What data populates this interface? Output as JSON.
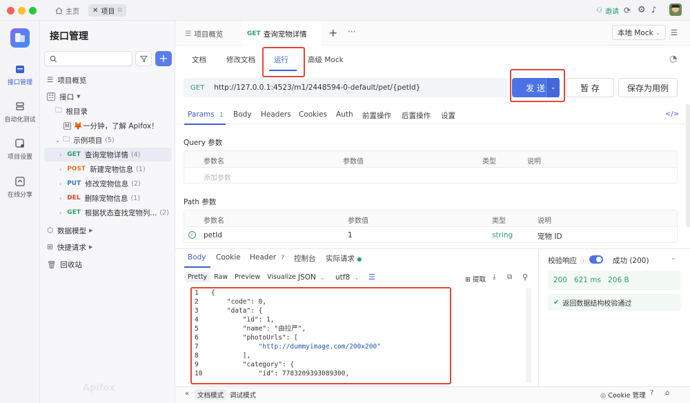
{
  "titlebar": {
    "home_label": "主页",
    "project_label": "项目",
    "invite_label": "邀请"
  },
  "sidebar": {
    "items": [
      {
        "label": "接口管理"
      },
      {
        "label": "自动化测试"
      },
      {
        "label": "项目设置"
      },
      {
        "label": "在线分享"
      }
    ]
  },
  "panel": {
    "title": "接口管理",
    "overview": "项目概览",
    "interfaces": "接口",
    "root": "根目录",
    "intro": "🦊一分钟，了解 Apifox！",
    "example_folder": "示例项目",
    "example_count": "(5)",
    "endpoints": [
      {
        "method": "GET",
        "color": "#2f9e6b",
        "name": "查询宠物详情",
        "count": "(4)"
      },
      {
        "method": "POST",
        "color": "#e0782a",
        "name": "新建宠物信息",
        "count": "(1)"
      },
      {
        "method": "PUT",
        "color": "#3a73c6",
        "name": "修改宠物信息",
        "count": "(2)"
      },
      {
        "method": "DEL",
        "color": "#d9432f",
        "name": "删除宠物信息",
        "count": "(1)"
      },
      {
        "method": "GET",
        "color": "#2f9e6b",
        "name": "根据状态查找宠物列...",
        "count": "(2)"
      }
    ],
    "data_models": "数据模型",
    "quick_request": "快捷请求",
    "recycle": "回收站",
    "watermark": "Apifox"
  },
  "top_tabs": {
    "overview": "项目概览",
    "active_method": "GET",
    "active_name": "查询宠物详情",
    "env": "本地 Mock"
  },
  "sub_tabs": [
    "文档",
    "修改文档",
    "运行",
    "高级 Mock"
  ],
  "request": {
    "method": "GET",
    "url": "http://127.0.0.1:4523/m1/2448594-0-default/pet/{petId}",
    "send": "发 送",
    "save": "暂 存",
    "save_case": "保存为用例"
  },
  "param_tabs": {
    "params": "Params",
    "params_count": "1",
    "body": "Body",
    "headers": "Headers",
    "cookies": "Cookies",
    "auth": "Auth",
    "pre": "前置操作",
    "post": "后置操作",
    "settings": "设置"
  },
  "query": {
    "title": "Query 参数",
    "col_name": "参数名",
    "col_value": "参数值",
    "col_type": "类型",
    "col_desc": "说明",
    "add_placeholder": "添加参数"
  },
  "path": {
    "title": "Path 参数",
    "col_name": "参数名",
    "col_value": "参数值",
    "col_type": "类型",
    "col_desc": "说明",
    "row": {
      "name": "petId",
      "value": "1",
      "type": "string",
      "desc": "宠物 ID"
    }
  },
  "response": {
    "tabs": {
      "body": "Body",
      "cookie": "Cookie",
      "header": "Header",
      "header_count": "7",
      "console": "控制台",
      "actual": "实际请求"
    },
    "views": [
      "Pretty",
      "Raw",
      "Preview",
      "Visualize"
    ],
    "format": "JSON",
    "encoding": "utf8",
    "extract": "提取",
    "validate_label": "校验响应",
    "success": "成功 (200)",
    "status": "200",
    "time": "621 ms",
    "size": "206 B",
    "validate_msg": "返回数据结构校验通过"
  },
  "code_lines": [
    {
      "n": "1",
      "t": "{"
    },
    {
      "n": "2",
      "t": "    \"code\": 0,"
    },
    {
      "n": "3",
      "t": "    \"data\": {"
    },
    {
      "n": "4",
      "t": "        \"id\": 1,"
    },
    {
      "n": "5",
      "t": "        \"name\": \"由拉严\","
    },
    {
      "n": "6",
      "t": "        \"photoUrls\": ["
    },
    {
      "n": "7",
      "t": "            \"http://dummyimage.com/200x200\""
    },
    {
      "n": "8",
      "t": "        ],"
    },
    {
      "n": "9",
      "t": "        \"category\": {"
    },
    {
      "n": "10",
      "t": "            \"id\": 7783209393089300,"
    }
  ],
  "footer": {
    "doc_mode": "文档模式",
    "debug_mode": "调试模式",
    "cookie_mgmt": "Cookie 管理"
  }
}
